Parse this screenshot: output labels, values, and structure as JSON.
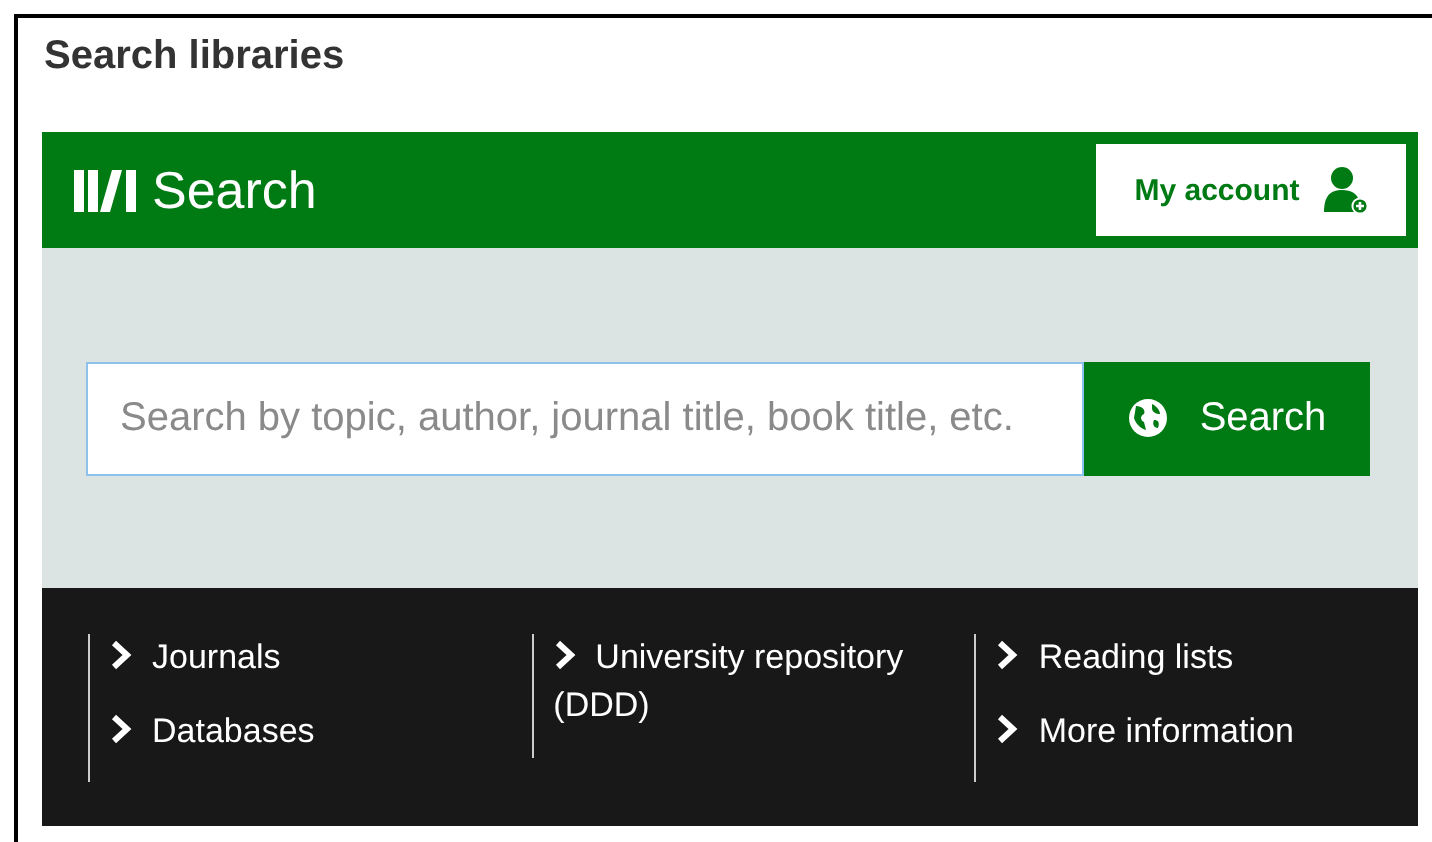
{
  "page_title": "Search libraries",
  "header": {
    "title": "Search",
    "account_button": "My account"
  },
  "search": {
    "placeholder": "Search by topic, author, journal title, book title, etc.",
    "button": "Search"
  },
  "link_columns": [
    {
      "links": [
        "Journals",
        "Databases"
      ]
    },
    {
      "links": [
        "University repository (DDD)"
      ]
    },
    {
      "links": [
        "Reading lists",
        "More information"
      ]
    }
  ]
}
